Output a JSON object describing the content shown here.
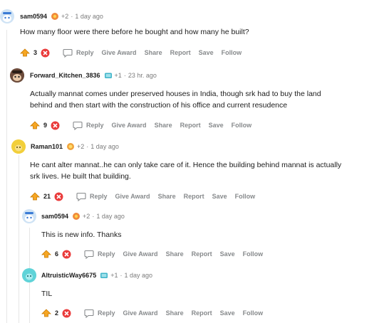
{
  "comments": [
    {
      "author": "sam0594",
      "karma": "+2",
      "dot": "·",
      "time": "1 day ago",
      "avatar_icon": "snoo-avatar-icon",
      "award_icon": "flower-award-icon",
      "body": "How many floor were there before he bought and how many he built?",
      "score": "3",
      "actions": {
        "reply": "Reply",
        "give_award": "Give Award",
        "share": "Share",
        "report": "Report",
        "save": "Save",
        "follow": "Follow"
      }
    },
    {
      "author": "Forward_Kitchen_3836",
      "karma": "+1",
      "dot": "·",
      "time": "23 hr. ago",
      "avatar_icon": "snoo-dark-avatar-icon",
      "award_icon": "tv-award-icon",
      "body": "Actually mannat comes under preserved houses in India, though srk had to buy the land behind and then start with the construction of his office and current resudence",
      "score": "9",
      "actions": {
        "reply": "Reply",
        "give_award": "Give Award",
        "share": "Share",
        "report": "Report",
        "save": "Save",
        "follow": "Follow"
      }
    },
    {
      "author": "Raman101",
      "karma": "+2",
      "dot": "·",
      "time": "1 day ago",
      "avatar_icon": "yellow-avatar-icon",
      "award_icon": "gold-award-icon",
      "body": "He cant alter mannat..he can only take care of it. Hence the building behind mannat is actually srk lives. He built that building.",
      "score": "21",
      "actions": {
        "reply": "Reply",
        "give_award": "Give Award",
        "share": "Share",
        "report": "Report",
        "save": "Save",
        "follow": "Follow"
      }
    },
    {
      "author": "sam0594",
      "karma": "+2",
      "dot": "·",
      "time": "1 day ago",
      "avatar_icon": "snoo-avatar-icon",
      "award_icon": "flower-award-icon",
      "body": "This is new info. Thanks",
      "score": "6",
      "actions": {
        "reply": "Reply",
        "give_award": "Give Award",
        "share": "Share",
        "report": "Report",
        "save": "Save",
        "follow": "Follow"
      }
    },
    {
      "author": "AltruisticWay6675",
      "karma": "+1",
      "dot": "·",
      "time": "1 day ago",
      "avatar_icon": "teal-avatar-icon",
      "award_icon": "tv-award-icon",
      "body": "TIL",
      "score": "2",
      "actions": {
        "reply": "Reply",
        "give_award": "Give Award",
        "share": "Share",
        "report": "Report",
        "save": "Save",
        "follow": "Follow"
      }
    }
  ],
  "colors": {
    "upvote": "#ff4500",
    "downvote": "#ea0027",
    "meta": "#7c7c7c",
    "action": "#878a8c"
  }
}
